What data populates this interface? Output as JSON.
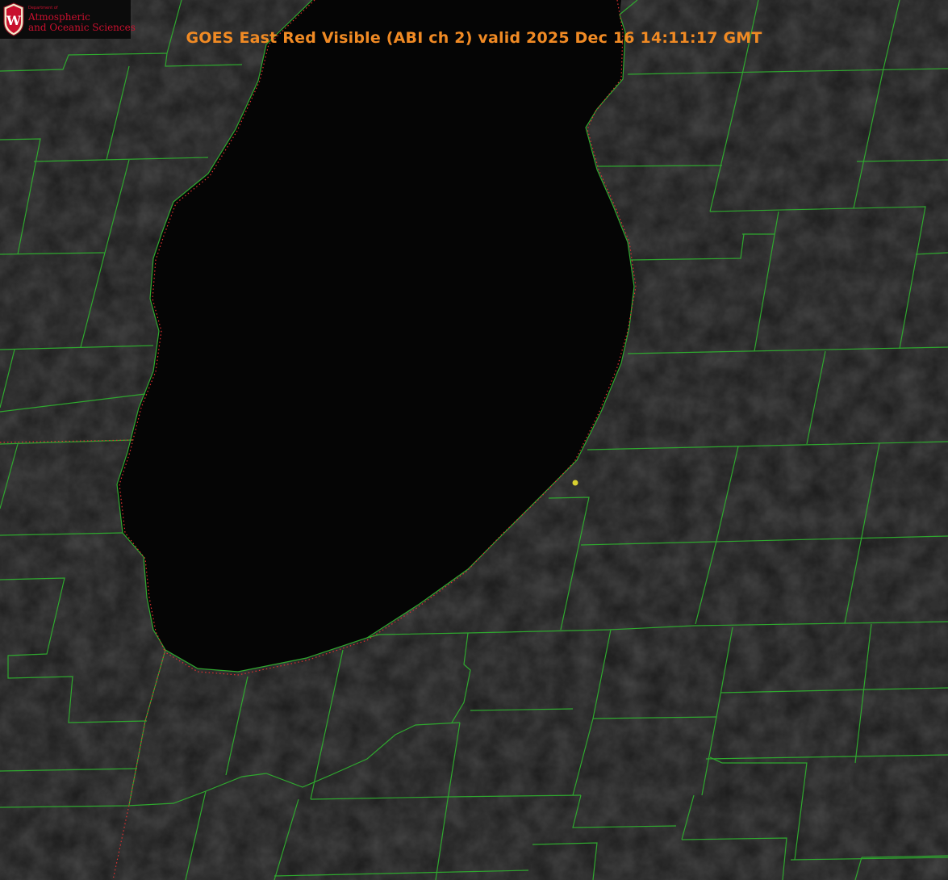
{
  "title": "GOES East Red Visible (ABI ch 2) valid 2025 Dec 16 14:11:17 GMT",
  "logo": {
    "department": "Department of",
    "line1": "Atmospheric",
    "line2": "and Oceanic Sciences",
    "seal_letter": "W"
  },
  "colors": {
    "land": "#1c1c1c",
    "lake": "#050505",
    "county_lines": "#2fa82f",
    "state_lines": "#e03030",
    "title": "#f08a24",
    "marker": "#d8d030",
    "logo_text": "#c8102e"
  },
  "layers": [
    "visible-satellite-imagery",
    "county-boundaries",
    "state-boundaries",
    "station-marker"
  ]
}
